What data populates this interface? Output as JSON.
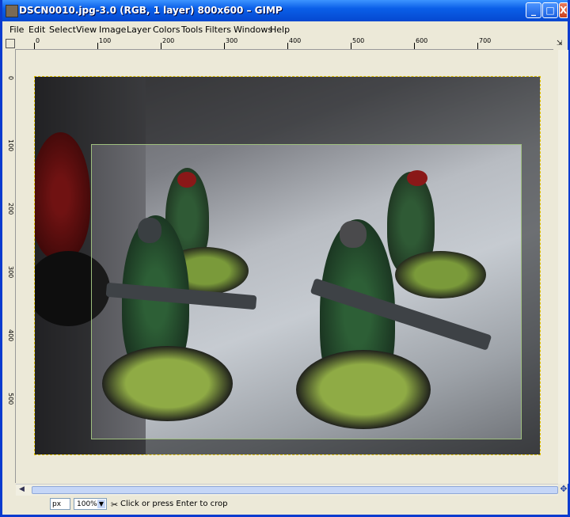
{
  "window": {
    "title": "DSCN0010.jpg-3.0 (RGB, 1 layer) 800x600 – GIMP",
    "buttons": {
      "minimize": "_",
      "maximize": "□",
      "close": "X"
    }
  },
  "menu": [
    "File",
    "Edit",
    "Select",
    "View",
    "Image",
    "Layer",
    "Colors",
    "Tools",
    "Filters",
    "Windows",
    "Help"
  ],
  "ruler_top": [
    "0",
    "100",
    "200",
    "300",
    "400",
    "500",
    "600",
    "700"
  ],
  "ruler_left": [
    "0",
    "100",
    "200",
    "300",
    "400",
    "500"
  ],
  "status": {
    "unit": "px",
    "zoom": "100%",
    "message": "Click or press Enter to crop"
  },
  "colors": {
    "titlebar": "#0a5fe8",
    "chrome": "#ece9d8",
    "crop_border": "#9fbf7f"
  }
}
